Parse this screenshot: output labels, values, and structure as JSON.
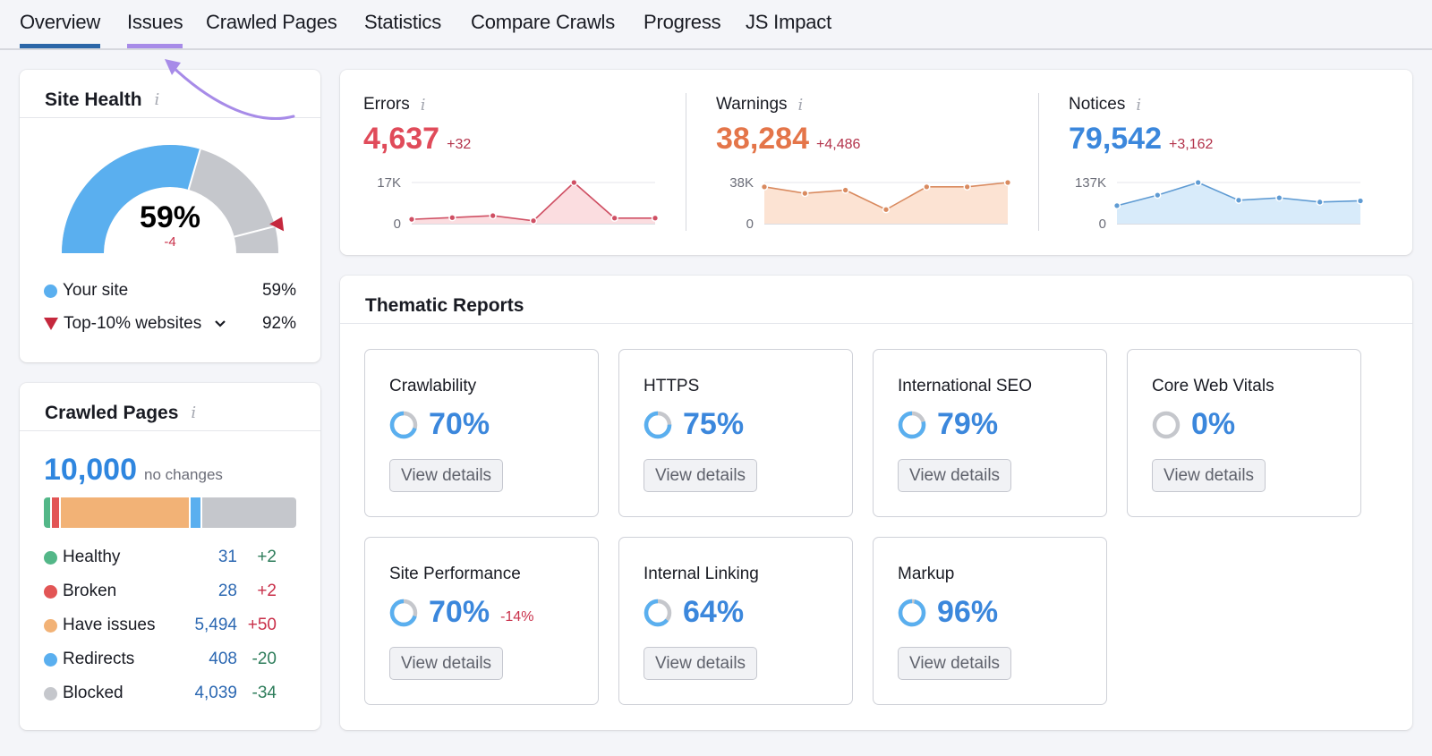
{
  "tabs": [
    {
      "label": "Overview",
      "active": true
    },
    {
      "label": "Issues",
      "highlighted": true
    },
    {
      "label": "Crawled Pages"
    },
    {
      "label": "Statistics"
    },
    {
      "label": "Compare Crawls"
    },
    {
      "label": "Progress"
    },
    {
      "label": "JS Impact"
    }
  ],
  "colors": {
    "active_tab": "#2b66a8",
    "highlight": "#a78be8",
    "blue": "#5aafef",
    "gray": "#c5c7cc",
    "red": "#c5283d",
    "errors": "#e04b5a",
    "warnings": "#e47549",
    "notices": "#3b87dc"
  },
  "site_health": {
    "title": "Site Health",
    "info_icon": "i",
    "score": "59%",
    "score_value": 59,
    "top10_value": 92,
    "delta": "-4",
    "legend": [
      {
        "label": "Your site",
        "value": "59%",
        "marker": "dot",
        "color": "#5aafef"
      },
      {
        "label": "Top-10% websites",
        "value": "92%",
        "marker": "triangle-down",
        "color": "#c5283d",
        "dropdown": true
      }
    ],
    "chevron_icon": "⌄"
  },
  "crawled_pages": {
    "title": "Crawled Pages",
    "total": "10,000",
    "note": "no changes",
    "segments": [
      {
        "name": "Healthy",
        "count": 31,
        "color": "#53b788"
      },
      {
        "name": "Broken",
        "count": 28,
        "color": "#e25555"
      },
      {
        "name": "Have issues",
        "count": 5494,
        "color": "#f2b276"
      },
      {
        "name": "Redirects",
        "count": 408,
        "color": "#5aafef"
      },
      {
        "name": "Blocked",
        "count": 4039,
        "color": "#c5c7cc"
      }
    ],
    "rows": [
      {
        "label": "Healthy",
        "count": "31",
        "delta": "+2",
        "delta_color": "#2e7d5b",
        "color": "#53b788"
      },
      {
        "label": "Broken",
        "count": "28",
        "delta": "+2",
        "delta_color": "#c9304a",
        "color": "#e25555"
      },
      {
        "label": "Have issues",
        "count": "5,494",
        "delta": "+50",
        "delta_color": "#c9304a",
        "color": "#f2b276"
      },
      {
        "label": "Redirects",
        "count": "408",
        "delta": "-20",
        "delta_color": "#2e7d5b",
        "color": "#5aafef"
      },
      {
        "label": "Blocked",
        "count": "4,039",
        "delta": "-34",
        "delta_color": "#2e7d5b",
        "color": "#c5c7cc"
      }
    ]
  },
  "metrics": [
    {
      "title": "Errors",
      "value": "4,637",
      "change": "+32",
      "color": "#e04b5a",
      "fill": "#fbdde0",
      "line": "#cf4f63",
      "y_max_label": "17K",
      "y_min_label": "0",
      "y_max": 17000,
      "series": [
        1800,
        2500,
        3300,
        1200,
        17000,
        2300,
        2300
      ]
    },
    {
      "title": "Warnings",
      "value": "38,284",
      "change": "+4,486",
      "color": "#e47549",
      "fill": "#fce3d3",
      "line": "#d98a5f",
      "y_max_label": "38K",
      "y_min_label": "0",
      "y_max": 38000,
      "series": [
        34000,
        28000,
        31000,
        13000,
        34000,
        34000,
        38000
      ]
    },
    {
      "title": "Notices",
      "value": "79,542",
      "change": "+3,162",
      "color": "#3b87dc",
      "fill": "#d8ebfa",
      "line": "#5f9bd3",
      "y_max_label": "137K",
      "y_min_label": "0",
      "y_max": 137000,
      "series": [
        60000,
        95000,
        137000,
        78000,
        86000,
        72000,
        76000
      ]
    }
  ],
  "chart_data": [
    {
      "type": "line",
      "title": "Errors",
      "x": [
        1,
        2,
        3,
        4,
        5,
        6,
        7
      ],
      "values": [
        1800,
        2500,
        3300,
        1200,
        17000,
        2300,
        2300
      ],
      "ylim": [
        0,
        17000
      ]
    },
    {
      "type": "line",
      "title": "Warnings",
      "x": [
        1,
        2,
        3,
        4,
        5,
        6,
        7
      ],
      "values": [
        34000,
        28000,
        31000,
        13000,
        34000,
        34000,
        38000
      ],
      "ylim": [
        0,
        38000
      ]
    },
    {
      "type": "line",
      "title": "Notices",
      "x": [
        1,
        2,
        3,
        4,
        5,
        6,
        7
      ],
      "values": [
        60000,
        95000,
        137000,
        78000,
        86000,
        72000,
        76000
      ],
      "ylim": [
        0,
        137000
      ]
    }
  ],
  "thematic": {
    "title": "Thematic Reports",
    "button_label": "View details",
    "reports": [
      {
        "name": "Crawlability",
        "score": "70%",
        "value": 70
      },
      {
        "name": "HTTPS",
        "score": "75%",
        "value": 75
      },
      {
        "name": "International SEO",
        "score": "79%",
        "value": 79
      },
      {
        "name": "Core Web Vitals",
        "score": "0%",
        "value": 0
      },
      {
        "name": "Site Performance",
        "score": "70%",
        "value": 70,
        "delta": "-14%"
      },
      {
        "name": "Internal Linking",
        "score": "64%",
        "value": 64
      },
      {
        "name": "Markup",
        "score": "96%",
        "value": 96
      }
    ]
  }
}
